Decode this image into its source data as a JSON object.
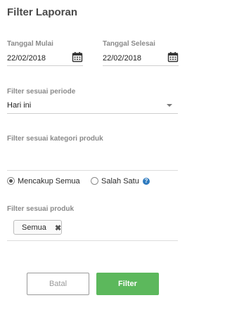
{
  "title": "Filter Laporan",
  "start_date": {
    "label": "Tanggal Mulai",
    "value": "22/02/2018",
    "icon": "calendar-icon"
  },
  "end_date": {
    "label": "Tanggal Selesai",
    "value": "22/02/2018",
    "icon": "calendar-icon"
  },
  "period": {
    "label": "Filter sesuai periode",
    "value": "Hari ini"
  },
  "category": {
    "label": "Filter sesuai kategori produk",
    "value": ""
  },
  "match_mode": {
    "options": [
      {
        "label": "Mencakup Semua",
        "checked": true
      },
      {
        "label": "Salah Satu",
        "checked": false
      }
    ],
    "help_icon": "help-icon"
  },
  "product": {
    "label": "Filter sesuai produk",
    "chips": [
      {
        "label": "Semua"
      }
    ]
  },
  "buttons": {
    "cancel": "Batal",
    "filter": "Filter"
  },
  "colors": {
    "accent": "#5cb85c",
    "help": "#2f7bbf"
  }
}
